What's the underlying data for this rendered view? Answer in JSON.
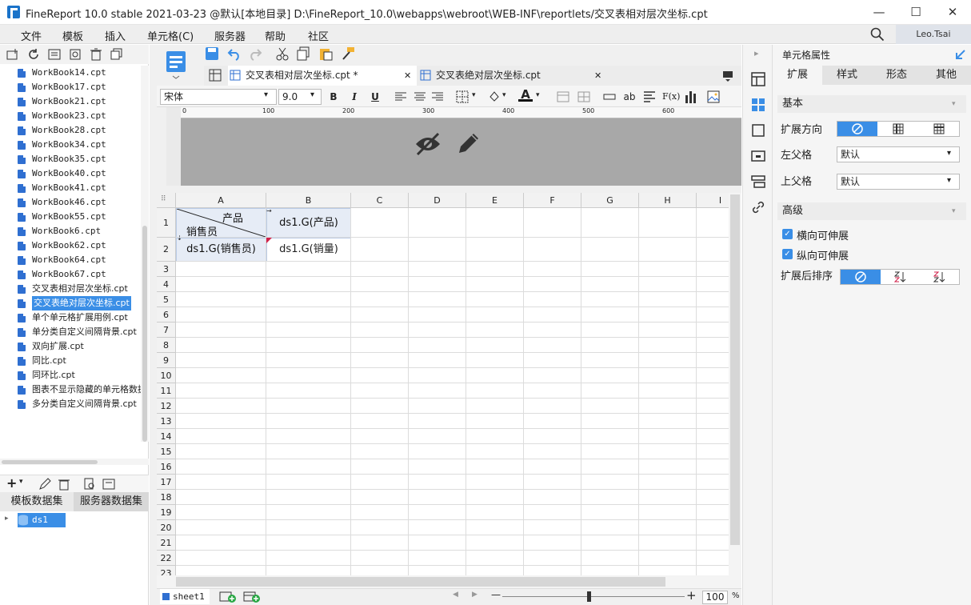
{
  "window": {
    "title": "FineReport 10.0 stable 2021-03-23 @默认[本地目录]    D:\\FineReport_10.0\\webapps\\webroot\\WEB-INF\\reportlets/交叉表相对层次坐标.cpt",
    "minimize": "—",
    "maximize": "☐",
    "close": "✕"
  },
  "menu": [
    "文件",
    "模板",
    "插入",
    "单元格(C)",
    "服务器",
    "帮助",
    "社区"
  ],
  "user": "Leo.Tsai",
  "file_list": [
    "WorkBook14.cpt",
    "WorkBook17.cpt",
    "WorkBook21.cpt",
    "WorkBook23.cpt",
    "WorkBook28.cpt",
    "WorkBook34.cpt",
    "WorkBook35.cpt",
    "WorkBook40.cpt",
    "WorkBook41.cpt",
    "WorkBook46.cpt",
    "WorkBook55.cpt",
    "WorkBook6.cpt",
    "WorkBook62.cpt",
    "WorkBook64.cpt",
    "WorkBook67.cpt",
    "交叉表相对层次坐标.cpt",
    "交叉表绝对层次坐标.cpt",
    "单个单元格扩展用例.cpt",
    "单分类自定义间隔背景.cpt",
    "双向扩展.cpt",
    "同比.cpt",
    "同环比.cpt",
    "图表不显示隐藏的单元格数据",
    "多分类自定义间隔背景.cpt"
  ],
  "selected_file_index": 16,
  "datasets": {
    "tab_template": "模板数据集",
    "tab_server": "服务器数据集",
    "items": [
      "ds1"
    ]
  },
  "tabs": [
    {
      "label": "交叉表相对层次坐标.cpt *",
      "close": "✕"
    },
    {
      "label": "交叉表绝对层次坐标.cpt",
      "close": "✕"
    }
  ],
  "format": {
    "font": "宋体",
    "size": "9.0",
    "bold": "B",
    "italic": "I",
    "underline": "U",
    "text_a": "A",
    "ab": "ab",
    "fx": "F(x)"
  },
  "ruler_ticks": [
    "0",
    "100",
    "200",
    "300",
    "400",
    "500",
    "600"
  ],
  "columns": [
    "A",
    "B",
    "C",
    "D",
    "E",
    "F",
    "G",
    "H",
    "I"
  ],
  "rows": [
    "1",
    "2",
    "3",
    "4",
    "5",
    "6",
    "7",
    "8",
    "9",
    "10",
    "11",
    "12",
    "13",
    "14",
    "15",
    "16",
    "17",
    "18",
    "19",
    "20",
    "21",
    "22",
    "23"
  ],
  "cells": {
    "a1_top": "产品",
    "a1_bottom": "销售员",
    "b1": "ds1.G(产品)",
    "a2": "ds1.G(销售员)",
    "b2": "ds1.G(销量)"
  },
  "sheet": "sheet1",
  "zoom": {
    "value": "100",
    "unit": "%",
    "minus": "—",
    "plus": "+"
  },
  "right_panel": {
    "title": "单元格属性",
    "tabs": [
      "扩展",
      "样式",
      "形态",
      "其他"
    ],
    "section_basic": "基本",
    "expand_direction_label": "扩展方向",
    "left_parent_label": "左父格",
    "left_parent_value": "默认",
    "top_parent_label": "上父格",
    "top_parent_value": "默认",
    "section_advanced": "高级",
    "horizontal_expand": "横向可伸展",
    "vertical_expand": "纵向可伸展",
    "sort_label": "扩展后排序",
    "check_mark": "✓"
  },
  "colors": {
    "accent": "#3a8ee6",
    "selected_cell_bg": "#e6ecf6"
  }
}
